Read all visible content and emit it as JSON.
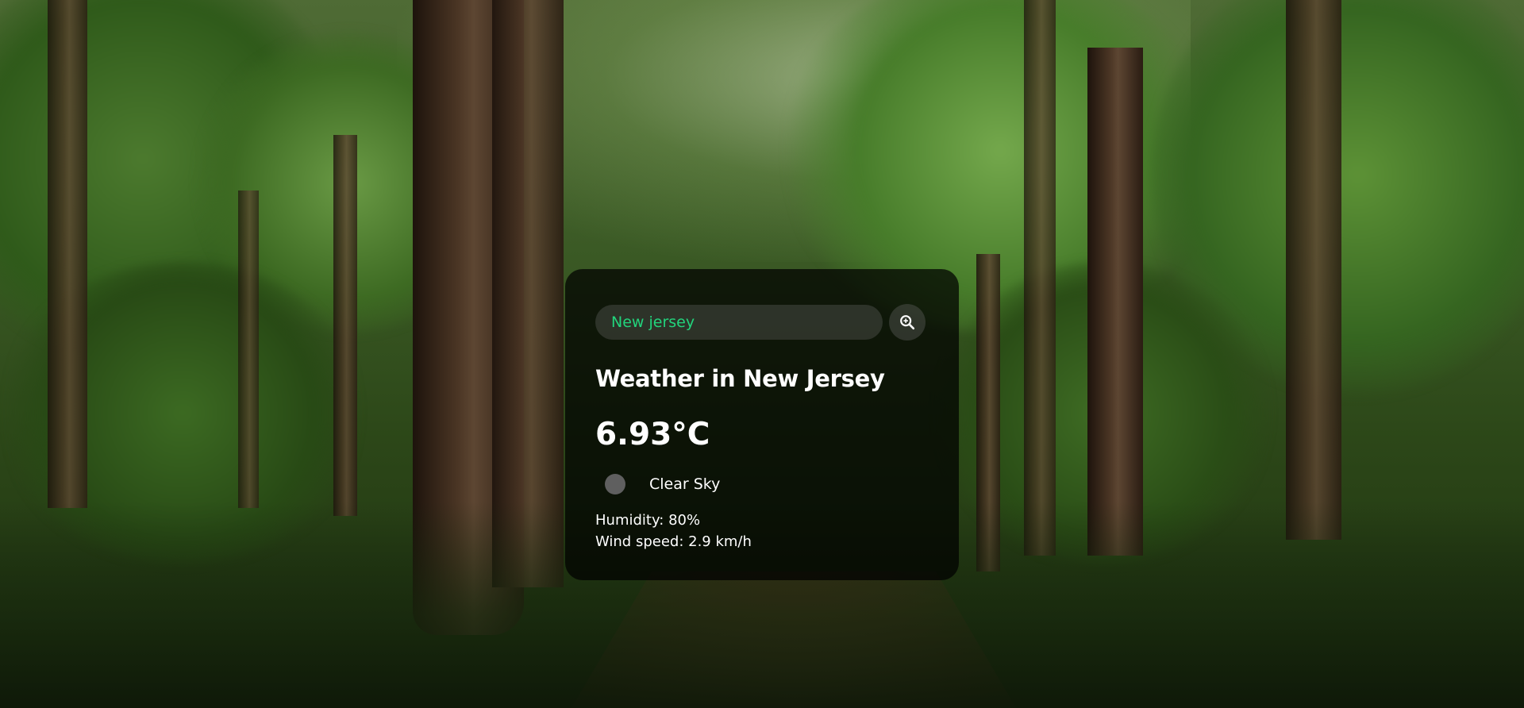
{
  "search": {
    "value": "New jersey",
    "placeholder": "Search"
  },
  "weather": {
    "title": "Weather in New Jersey",
    "temperature": "6.93°C",
    "description": "Clear Sky",
    "humidity": "Humidity: 80%",
    "wind": "Wind speed: 2.9 km/h",
    "icon": "weather-condition-icon"
  },
  "icons": {
    "search": "search-zoom-icon"
  },
  "colors": {
    "search_text": "#22d47c",
    "card_background": "rgba(0,0,0,0.72)",
    "text": "#ffffff"
  }
}
